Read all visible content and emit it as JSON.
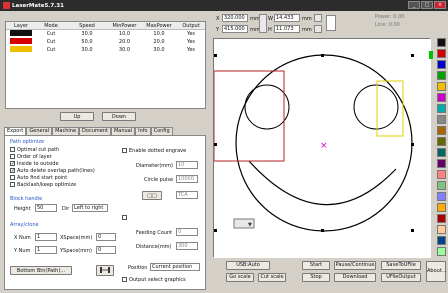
{
  "window": {
    "title": "LaserMate5.7.31"
  },
  "layer_table": {
    "headers": [
      "Layer",
      "Mode",
      "Speed",
      "MinPower",
      "MaxPower",
      "Output"
    ],
    "rows": [
      {
        "color": "#111111",
        "mode": "Cut",
        "speed": "30.0",
        "min": "10.0",
        "max": "10.0",
        "out": "Yes"
      },
      {
        "color": "#d40000",
        "mode": "Cut",
        "speed": "50.0",
        "min": "20.0",
        "max": "20.0",
        "out": "Yes"
      },
      {
        "color": "#f0c000",
        "mode": "Cut",
        "speed": "30.0",
        "min": "30.0",
        "max": "30.0",
        "out": "Yes"
      }
    ]
  },
  "layer_buttons": {
    "up": "Up",
    "down": "Down"
  },
  "tabs": [
    "Export",
    "General",
    "Machine",
    "Document",
    "Manual",
    "Info",
    "Config"
  ],
  "export": {
    "path_optimize_title": "Path optimize",
    "checks": [
      {
        "label": "Optimal cut path",
        "checked": false
      },
      {
        "label": "Order of layer",
        "checked": false
      },
      {
        "label": "Inside to outside",
        "checked": true
      },
      {
        "label": "Auto delete overlap path(lines)",
        "checked": true
      },
      {
        "label": "Auto find start point",
        "checked": false
      },
      {
        "label": "Backlash/keep optimize",
        "checked": false
      }
    ],
    "block_title": "Block handle",
    "height_label": "Height",
    "height_value": "50",
    "dir_label": "Dir",
    "dir_value": "Left to right",
    "array_title": "Array/clone",
    "xnum_label": "X Num",
    "xnum_value": "1",
    "xspace_label": "XSpace(mm)",
    "xspace_value": "0",
    "ynum_label": "Y Num",
    "ynum_value": "1",
    "yspace_label": "YSpace(mm)",
    "yspace_value": "0",
    "bottom_btn": "Bottom Btn(Path)...",
    "enable_dotted": "Enable dotted engrave",
    "diameter_label": "Diameter(mm)",
    "diameter_value": "10",
    "circle_pulse_label": "Circle pulse",
    "circle_pulse_value": "10000",
    "small_btn": "□□",
    "tca_value": "TCA",
    "feeding_label": "Feeding Count",
    "feeding_value": "0",
    "distance_label": "Distance(mm)",
    "distance_value": "300",
    "position_label": "Position",
    "position_value": "Current position",
    "output_selected": "Output select graphics"
  },
  "coords": {
    "x_label": "X",
    "x_value": "320.000",
    "y_label": "Y",
    "y_value": "415.000",
    "unit": "mm",
    "w_label": "W",
    "w_value": "14.433",
    "h_label": "H",
    "h_value": "11.073",
    "power_label": "Power: 0.00",
    "line_label": "Line: 0.00"
  },
  "buttons": {
    "usb_auto": "USB:Auto",
    "start": "Start",
    "pause": "Pause/Continue",
    "save_file": "SaveToUFile",
    "go_scale": "Go scale",
    "cut_scale": "Cut scale",
    "stop": "Stop",
    "download": "Download",
    "ufile_output": "UFileOutput",
    "about": "About..."
  },
  "palette": [
    "#111111",
    "#d40000",
    "#0000cc",
    "#00a000",
    "#f0c000",
    "#cc00cc",
    "#00aaaa",
    "#888888",
    "#aa6600",
    "#666600",
    "#006666",
    "#660066",
    "#ff8080",
    "#80c080",
    "#8080ff",
    "#ffaa00",
    "#aa0000",
    "#ffcc99",
    "#004488",
    "#99ff99"
  ],
  "accent": "#2a55c8"
}
